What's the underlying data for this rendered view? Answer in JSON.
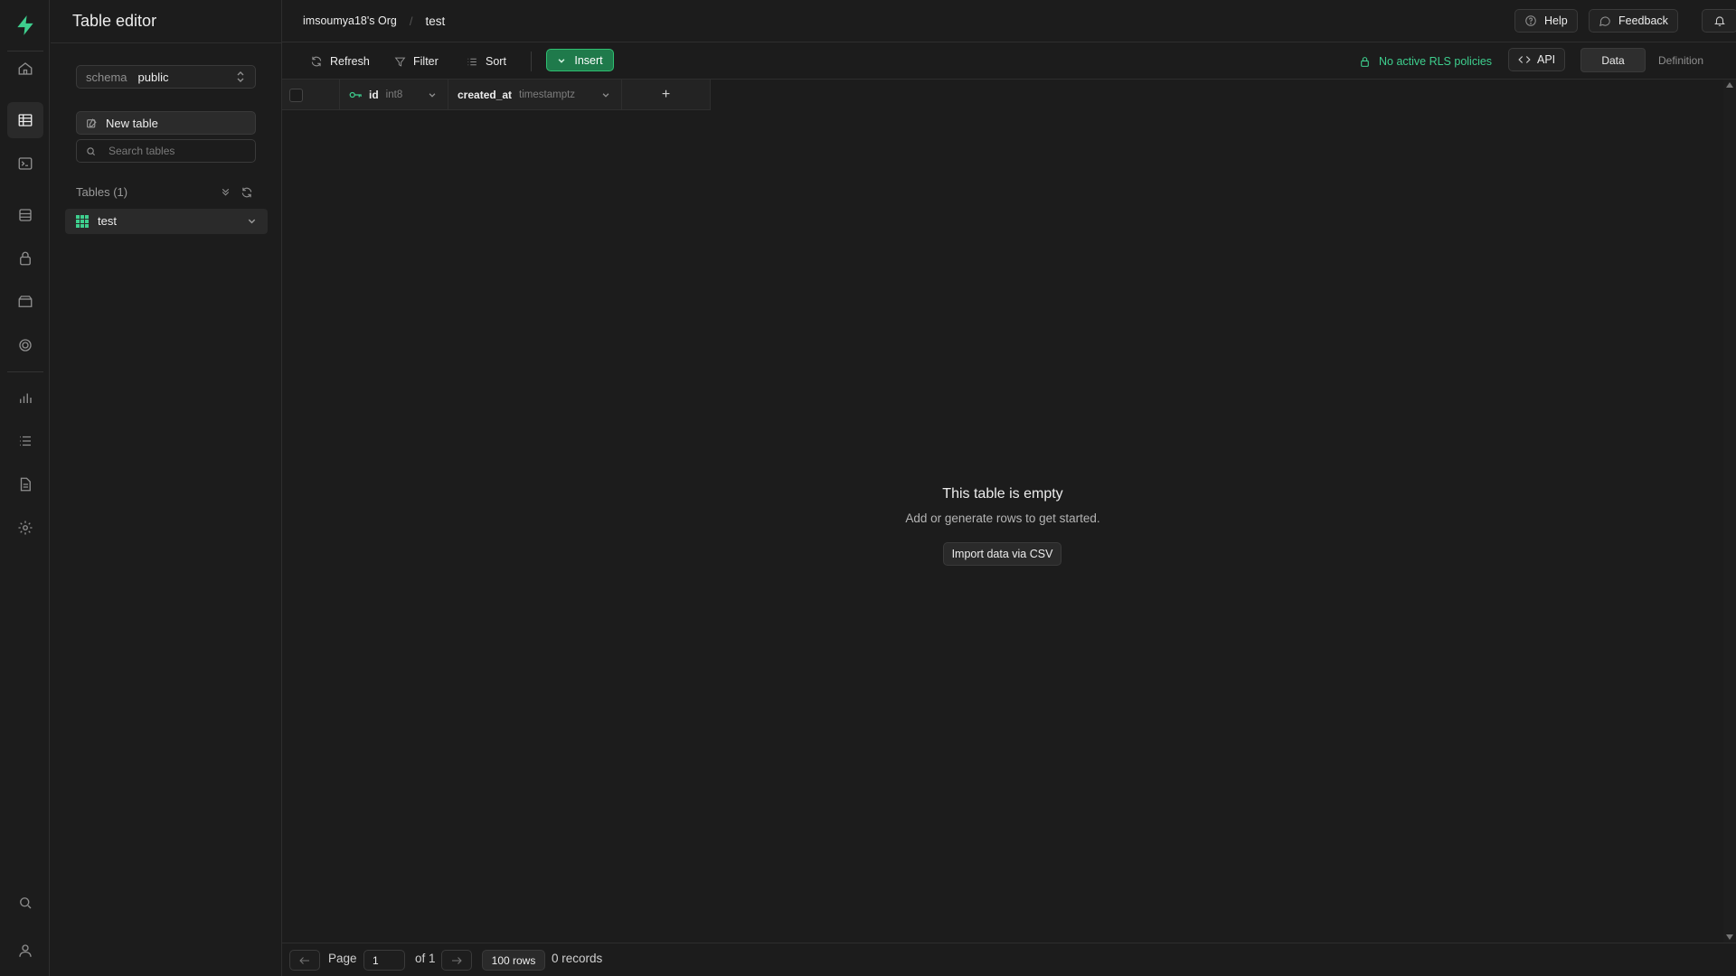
{
  "app": {
    "title": "Table editor"
  },
  "colors": {
    "accent": "#3ecf8e",
    "insert_bg": "#1f7a4b",
    "background": "#1c1c1c"
  },
  "activity_bar": {
    "items": [
      {
        "name": "home",
        "icon": "home-icon"
      },
      {
        "name": "table-editor",
        "icon": "table-icon",
        "active": true
      },
      {
        "name": "sql-editor",
        "icon": "terminal-icon"
      },
      {
        "name": "database",
        "icon": "database-icon"
      },
      {
        "name": "authentication",
        "icon": "lock-icon"
      },
      {
        "name": "storage",
        "icon": "archive-icon"
      },
      {
        "name": "realtime",
        "icon": "realtime-icon"
      },
      {
        "name": "reports",
        "icon": "bar-chart-icon"
      },
      {
        "name": "logs",
        "icon": "list-icon"
      },
      {
        "name": "api-docs",
        "icon": "document-icon"
      },
      {
        "name": "settings",
        "icon": "gear-icon"
      },
      {
        "name": "search",
        "icon": "search-icon"
      },
      {
        "name": "account",
        "icon": "user-icon"
      }
    ]
  },
  "sidebar": {
    "schema_label": "schema",
    "schema_value": "public",
    "new_table_label": "New table",
    "search_placeholder": "Search tables",
    "tables_heading": "Tables (1)",
    "tables": [
      {
        "name": "test"
      }
    ]
  },
  "topbar": {
    "org": "imsoumya18's Org",
    "separator": "/",
    "current": "test",
    "help_label": "Help",
    "feedback_label": "Feedback"
  },
  "toolbar": {
    "refresh_label": "Refresh",
    "filter_label": "Filter",
    "sort_label": "Sort",
    "insert_label": "Insert",
    "rls_label": "No active RLS policies",
    "api_label": "API",
    "data_tab": "Data",
    "definition_tab": "Definition"
  },
  "grid": {
    "columns": [
      {
        "name": "id",
        "type": "int8",
        "primary_key": true
      },
      {
        "name": "created_at",
        "type": "timestamptz",
        "primary_key": false
      }
    ],
    "add_column": "+",
    "empty_title": "This table is empty",
    "empty_subtitle": "Add or generate rows to get started.",
    "import_label": "Import data via CSV"
  },
  "footer": {
    "page_label": "Page",
    "page_value": "1",
    "of_label": "of 1",
    "rows_label": "100 rows",
    "records_label": "0 records"
  }
}
